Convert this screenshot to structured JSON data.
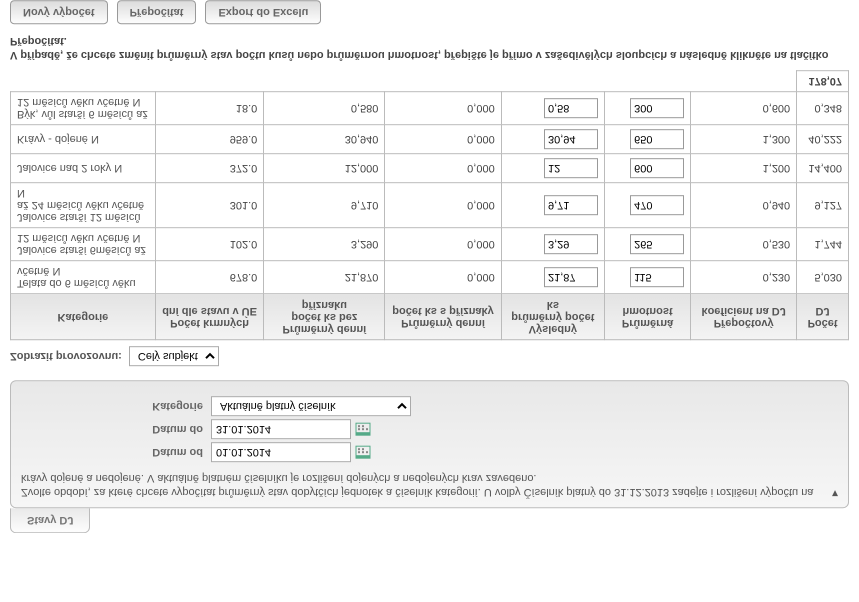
{
  "tab": {
    "title": "Stavy DJ"
  },
  "desc": {
    "text": "Zvolte období, za které chcete vypočítat průměrný stav dobytčích jednotek a číselník kategorií. U volby Číselník platný do 31.12.2013 zadejte i rozlišení výpočtu na krávy dojené a nedojené. V aktuálně platném číselníku je rozlišení dojených a nedojených krav zavedeno."
  },
  "form": {
    "date_from_label": "Datum od",
    "date_from": "01.01.2014",
    "date_to_label": "Datum do",
    "date_to": "31.01.2014",
    "category_label": "Kategorie",
    "category_value": "Aktuálně platný číselník"
  },
  "filter": {
    "label": "Zobrazit provozovnu:",
    "value": "Celý subjekt"
  },
  "table": {
    "headers": {
      "kategorie": "Kategorie",
      "pocet_krmnych": "Počet krmných dní dle stavu v ÚE",
      "prum_bez": "Průměrný denní počet ks bez příznaku",
      "prum_s": "Průměrný denní počet ks s příznaky",
      "vysledny": "Výsledný průměrný počet ks",
      "prum_hmot": "Průměrná hmotnost",
      "prep_koef": "Přepočtový koeficient na DJ",
      "pocet_dj": "Počet DJ"
    },
    "rows": [
      {
        "cat": "Telata do 6 měsíců věku včetně N",
        "c1": "678.0",
        "c2": "21,870",
        "c3": "0,000",
        "v": "21,87",
        "h": "115",
        "k": "0,230",
        "dj": "5,030"
      },
      {
        "cat": "Jalovice starší 6měsíců až 12 měsíců věku včetně N",
        "c1": "102.0",
        "c2": "3,290",
        "c3": "0,000",
        "v": "3,29",
        "h": "265",
        "k": "0,530",
        "dj": "1,744"
      },
      {
        "cat": "Jalovice starší 12 měsíců až 24 měsíců věku včetně N",
        "c1": "301.0",
        "c2": "9,710",
        "c3": "0,000",
        "v": "9,71",
        "h": "470",
        "k": "0,940",
        "dj": "9,127"
      },
      {
        "cat": "Jalovice nad 2 roky N",
        "c1": "372.0",
        "c2": "12,000",
        "c3": "0,000",
        "v": "12",
        "h": "600",
        "k": "1,200",
        "dj": "14,400"
      },
      {
        "cat": "Krávy - dojené N",
        "c1": "959.0",
        "c2": "30,940",
        "c3": "0,000",
        "v": "30,94",
        "h": "650",
        "k": "1,300",
        "dj": "40,222"
      },
      {
        "cat": "Býk, vůl starší 6 měsíců až 12 měsíců věku včetně N",
        "c1": "18.0",
        "c2": "0,580",
        "c3": "0,000",
        "v": "0,58",
        "h": "300",
        "k": "0,600",
        "dj": "0,348"
      }
    ],
    "total": {
      "dj": "178,07"
    }
  },
  "note": "V případě, že chcete změnit průměrný stav počtu kusů nebo průměrnou hmotnost, přepište je přímo v zašedivělých sloupcích a následně klikněte na tlačítko Přepočítat.",
  "buttons": {
    "novy": "Nový výpočet",
    "prepocitat": "Přepočítat",
    "export": "Export do Excelu"
  }
}
